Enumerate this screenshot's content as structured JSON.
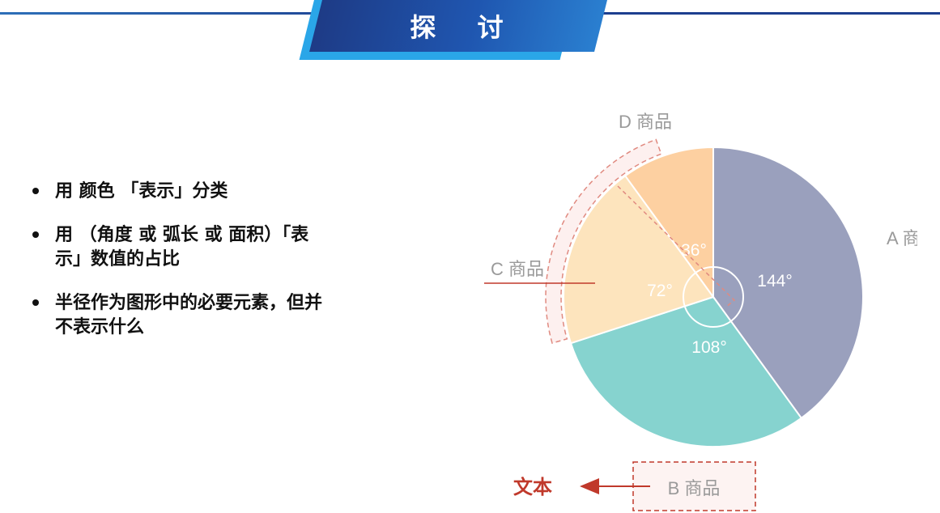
{
  "header": {
    "title": "探 讨"
  },
  "bullets": [
    "用 颜色 「表示」分类",
    "用 （角度 或 弧长 或 面积）「表\n示」数值的占比",
    "半径作为图形中的必要元素，但并\n不表示什么"
  ],
  "chart_data": {
    "type": "pie",
    "unit": "°",
    "slices": [
      {
        "label": "A 商品",
        "value": 144,
        "value_label": "144°",
        "color": "#9aa0bd"
      },
      {
        "label": "B 商品",
        "value": 108,
        "value_label": "108°",
        "color": "#86d3cf"
      },
      {
        "label": "C 商品",
        "value": 72,
        "value_label": "72°",
        "color": "#fde4bd"
      },
      {
        "label": "D 商品",
        "value": 36,
        "value_label": "36°",
        "color": "#fdd0a1"
      }
    ],
    "annotation": {
      "text": "文本",
      "color": "#c0392b"
    }
  }
}
